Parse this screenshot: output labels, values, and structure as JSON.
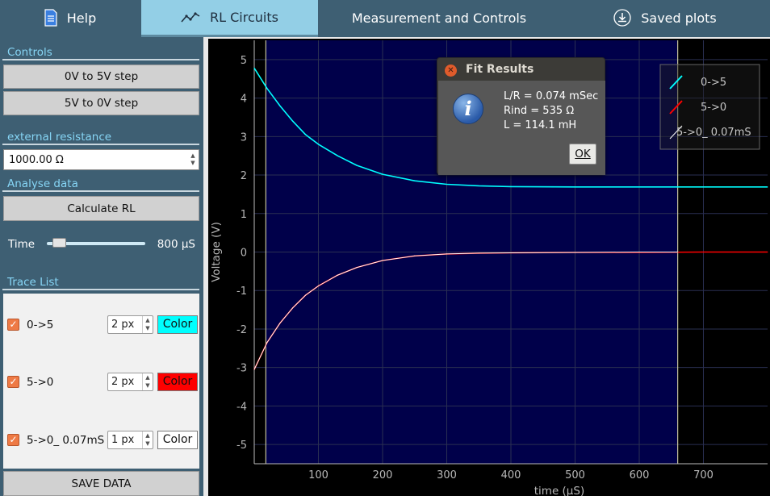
{
  "tabs": [
    {
      "label": "Help",
      "icon": "document-icon"
    },
    {
      "label": "RL Circuits",
      "icon": "chart-line-icon"
    },
    {
      "label": "Measurement and Controls",
      "icon": ""
    },
    {
      "label": "Saved plots",
      "icon": "download-icon"
    }
  ],
  "sidebar": {
    "controls_title": "Controls",
    "step_up_label": "0V to 5V step",
    "step_down_label": "5V to 0V step",
    "resistance_title": "external resistance",
    "resistance_value": "1000.00 Ω",
    "analyse_title": "Analyse data",
    "calculate_label": "Calculate RL",
    "time_label": "Time",
    "time_value": "800 µS",
    "time_slider_fraction": 0.12,
    "trace_title": "Trace List",
    "traces": [
      {
        "name": "0->5",
        "width": "2 px",
        "color_label": "Color",
        "color": "#00ffff",
        "checked": true
      },
      {
        "name": "5->0",
        "width": "2 px",
        "color_label": "Color",
        "color": "#ff0000",
        "checked": true
      },
      {
        "name": "5->0_ 0.07mS",
        "width": "1 px",
        "color_label": "Color",
        "color": "#ffffff",
        "checked": true
      }
    ],
    "save_label": "SAVE DATA"
  },
  "dialog": {
    "title": "Fit Results",
    "line1": "L/R = 0.074 mSec",
    "line2": "Rind =   535 Ω",
    "line3": "L = 114.1 mH",
    "ok_label": "OK"
  },
  "chart_data": {
    "type": "line",
    "xlabel": "time (µS)",
    "ylabel": "Voltage (V)",
    "xlim": [
      0,
      800
    ],
    "ylim": [
      -5.5,
      5.5
    ],
    "xticks": [
      100,
      200,
      300,
      400,
      500,
      600,
      700
    ],
    "yticks": [
      5,
      4,
      3,
      2,
      1,
      0,
      -1,
      -2,
      -3,
      -4,
      -5
    ],
    "grid": true,
    "region": {
      "x0": 18,
      "x1": 660,
      "fill": "#00004a"
    },
    "legend_position": "top-right",
    "series": [
      {
        "name": "0->5",
        "color": "#00ffff",
        "x": [
          0,
          20,
          40,
          60,
          80,
          100,
          130,
          160,
          200,
          250,
          300,
          350,
          400,
          500,
          600,
          700,
          800
        ],
        "y": [
          4.78,
          4.25,
          3.8,
          3.4,
          3.05,
          2.8,
          2.5,
          2.25,
          2.02,
          1.85,
          1.76,
          1.72,
          1.7,
          1.69,
          1.69,
          1.69,
          1.69
        ]
      },
      {
        "name": "5->0",
        "color": "#ff0000",
        "x": [
          0,
          20,
          40,
          60,
          80,
          100,
          130,
          160,
          200,
          250,
          300,
          350,
          400,
          500,
          600,
          700,
          800
        ],
        "y": [
          -3.05,
          -2.35,
          -1.85,
          -1.45,
          -1.12,
          -0.88,
          -0.6,
          -0.4,
          -0.22,
          -0.1,
          -0.05,
          -0.03,
          -0.02,
          -0.01,
          -0.01,
          0,
          0
        ]
      },
      {
        "name": "5->0_ 0.07mS",
        "color": "#ffffff",
        "x": [
          0,
          20,
          40,
          60,
          80,
          100,
          130,
          160,
          200,
          250,
          300,
          350,
          400,
          500,
          600,
          660
        ],
        "y": [
          -3.05,
          -2.35,
          -1.85,
          -1.45,
          -1.12,
          -0.88,
          -0.6,
          -0.4,
          -0.22,
          -0.1,
          -0.05,
          -0.03,
          -0.02,
          -0.01,
          0,
          0
        ]
      }
    ]
  }
}
